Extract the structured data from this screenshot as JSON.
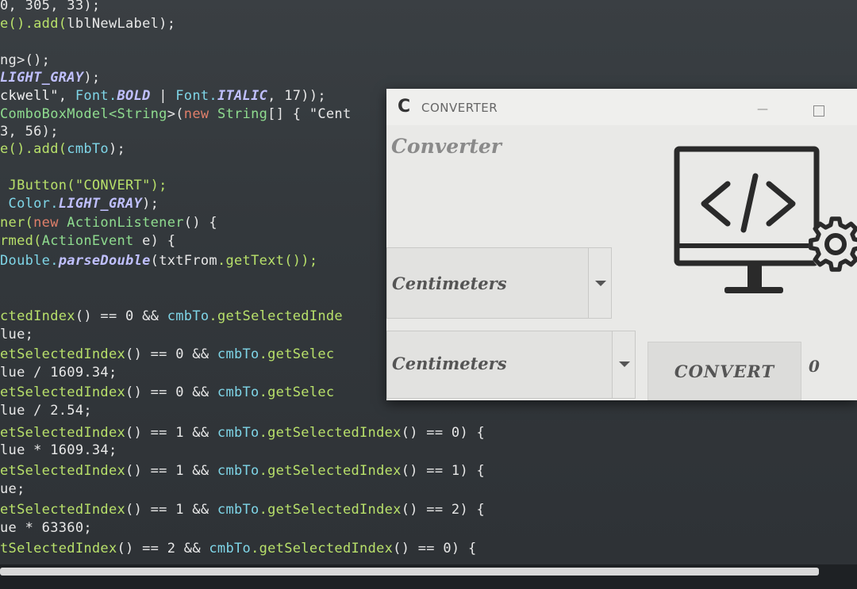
{
  "editor": {
    "lines": [
      [
        {
          "t": "0, 305, 33);",
          "c": "plain"
        }
      ],
      [
        {
          "t": "e().add(",
          "c": "method"
        },
        {
          "t": "lblNewLabel",
          "c": "plain"
        },
        {
          "t": ");",
          "c": "plain"
        }
      ],
      [
        {
          "t": "",
          "c": "plain"
        }
      ],
      [
        {
          "t": "ng>();",
          "c": "plain"
        }
      ],
      [
        {
          "t": "LIGHT_GRAY",
          "c": "const"
        },
        {
          "t": ");",
          "c": "plain"
        }
      ],
      [
        {
          "t": "ckwell\", ",
          "c": "string"
        },
        {
          "t": "Font.",
          "c": "obj"
        },
        {
          "t": "BOLD",
          "c": "const"
        },
        {
          "t": " | ",
          "c": "plain"
        },
        {
          "t": "Font.",
          "c": "obj"
        },
        {
          "t": "ITALIC",
          "c": "const"
        },
        {
          "t": ", 17));",
          "c": "plain"
        }
      ],
      [
        {
          "t": "ComboBoxModel<",
          "c": "type"
        },
        {
          "t": "String",
          "c": "type"
        },
        {
          "t": ">(",
          "c": "plain"
        },
        {
          "t": "new ",
          "c": "kw"
        },
        {
          "t": "String",
          "c": "type"
        },
        {
          "t": "[] { \"Cent",
          "c": "plain"
        }
      ],
      [
        {
          "t": "3, 56);",
          "c": "plain"
        }
      ],
      [
        {
          "t": "e().add(",
          "c": "method"
        },
        {
          "t": "cmbTo",
          "c": "obj"
        },
        {
          "t": ");",
          "c": "plain"
        }
      ],
      [
        {
          "t": "",
          "c": "plain"
        }
      ],
      [
        {
          "t": " JButton(\"CONVERT\");",
          "c": "method"
        }
      ],
      [
        {
          "t": " Color.",
          "c": "obj"
        },
        {
          "t": "LIGHT_GRAY",
          "c": "const"
        },
        {
          "t": ");",
          "c": "plain"
        }
      ],
      [
        {
          "t": "ner(",
          "c": "method"
        },
        {
          "t": "new ",
          "c": "kw"
        },
        {
          "t": "ActionListener",
          "c": "type"
        },
        {
          "t": "() {",
          "c": "plain"
        }
      ],
      [
        {
          "t": "rmed(",
          "c": "method"
        },
        {
          "t": "ActionEvent ",
          "c": "type"
        },
        {
          "t": "e) {",
          "c": "plain"
        }
      ],
      [
        {
          "t": "Double.",
          "c": "obj"
        },
        {
          "t": "parseDouble",
          "c": "const"
        },
        {
          "t": "(",
          "c": "plain"
        },
        {
          "t": "txtFrom",
          "c": "plain"
        },
        {
          "t": ".getText());",
          "c": "method"
        }
      ],
      [
        {
          "t": "",
          "c": "plain"
        }
      ],
      [
        {
          "t": "ctedIndex",
          "c": "method"
        },
        {
          "t": "() == 0 && ",
          "c": "plain"
        },
        {
          "t": "cmbTo",
          "c": "obj"
        },
        {
          "t": ".getSelectedInde",
          "c": "method"
        }
      ],
      [
        {
          "t": "lue;",
          "c": "plain"
        }
      ],
      [
        {
          "t": "etSelectedIndex",
          "c": "method"
        },
        {
          "t": "() == 0 && ",
          "c": "plain"
        },
        {
          "t": "cmbTo",
          "c": "obj"
        },
        {
          "t": ".getSelec",
          "c": "method"
        }
      ],
      [
        {
          "t": "lue / 1609.34;",
          "c": "plain"
        }
      ],
      [
        {
          "t": "etSelectedIndex",
          "c": "method"
        },
        {
          "t": "() == 0 && ",
          "c": "plain"
        },
        {
          "t": "cmbTo",
          "c": "obj"
        },
        {
          "t": ".getSelec",
          "c": "method"
        }
      ],
      [
        {
          "t": "lue / 2.54;",
          "c": "plain"
        }
      ],
      [
        {
          "t": "etSelectedIndex",
          "c": "method"
        },
        {
          "t": "() == 1 && ",
          "c": "plain"
        },
        {
          "t": "cmbTo",
          "c": "obj"
        },
        {
          "t": ".getSelectedIndex",
          "c": "method"
        },
        {
          "t": "() == 0) {",
          "c": "plain"
        }
      ],
      [
        {
          "t": "lue * 1609.34;",
          "c": "plain"
        }
      ],
      [
        {
          "t": "etSelectedIndex",
          "c": "method"
        },
        {
          "t": "() == 1 && ",
          "c": "plain"
        },
        {
          "t": "cmbTo",
          "c": "obj"
        },
        {
          "t": ".getSelectedIndex",
          "c": "method"
        },
        {
          "t": "() == 1) {",
          "c": "plain"
        }
      ],
      [
        {
          "t": "ue;",
          "c": "plain"
        }
      ],
      [
        {
          "t": "etSelectedIndex",
          "c": "method"
        },
        {
          "t": "() == 1 && ",
          "c": "plain"
        },
        {
          "t": "cmbTo",
          "c": "obj"
        },
        {
          "t": ".getSelectedIndex",
          "c": "method"
        },
        {
          "t": "() == 2) {",
          "c": "plain"
        }
      ],
      [
        {
          "t": "ue * 63360;",
          "c": "plain"
        }
      ],
      [
        {
          "t": "tSelectedIndex",
          "c": "method"
        },
        {
          "t": "() == 2 && ",
          "c": "plain"
        },
        {
          "t": "cmbTo",
          "c": "obj"
        },
        {
          "t": ".getSelectedIndex",
          "c": "method"
        },
        {
          "t": "() == 0) {",
          "c": "plain"
        }
      ]
    ]
  },
  "window": {
    "title": "CONVERTER",
    "icon_letter": "C",
    "minimize_glyph": "—",
    "heading": "Converter",
    "from_unit": "Centimeters",
    "to_unit": "Centimeters",
    "convert_label": "CONVERT",
    "result": "0",
    "illustration_icon": "monitor-code-gear-icon"
  }
}
